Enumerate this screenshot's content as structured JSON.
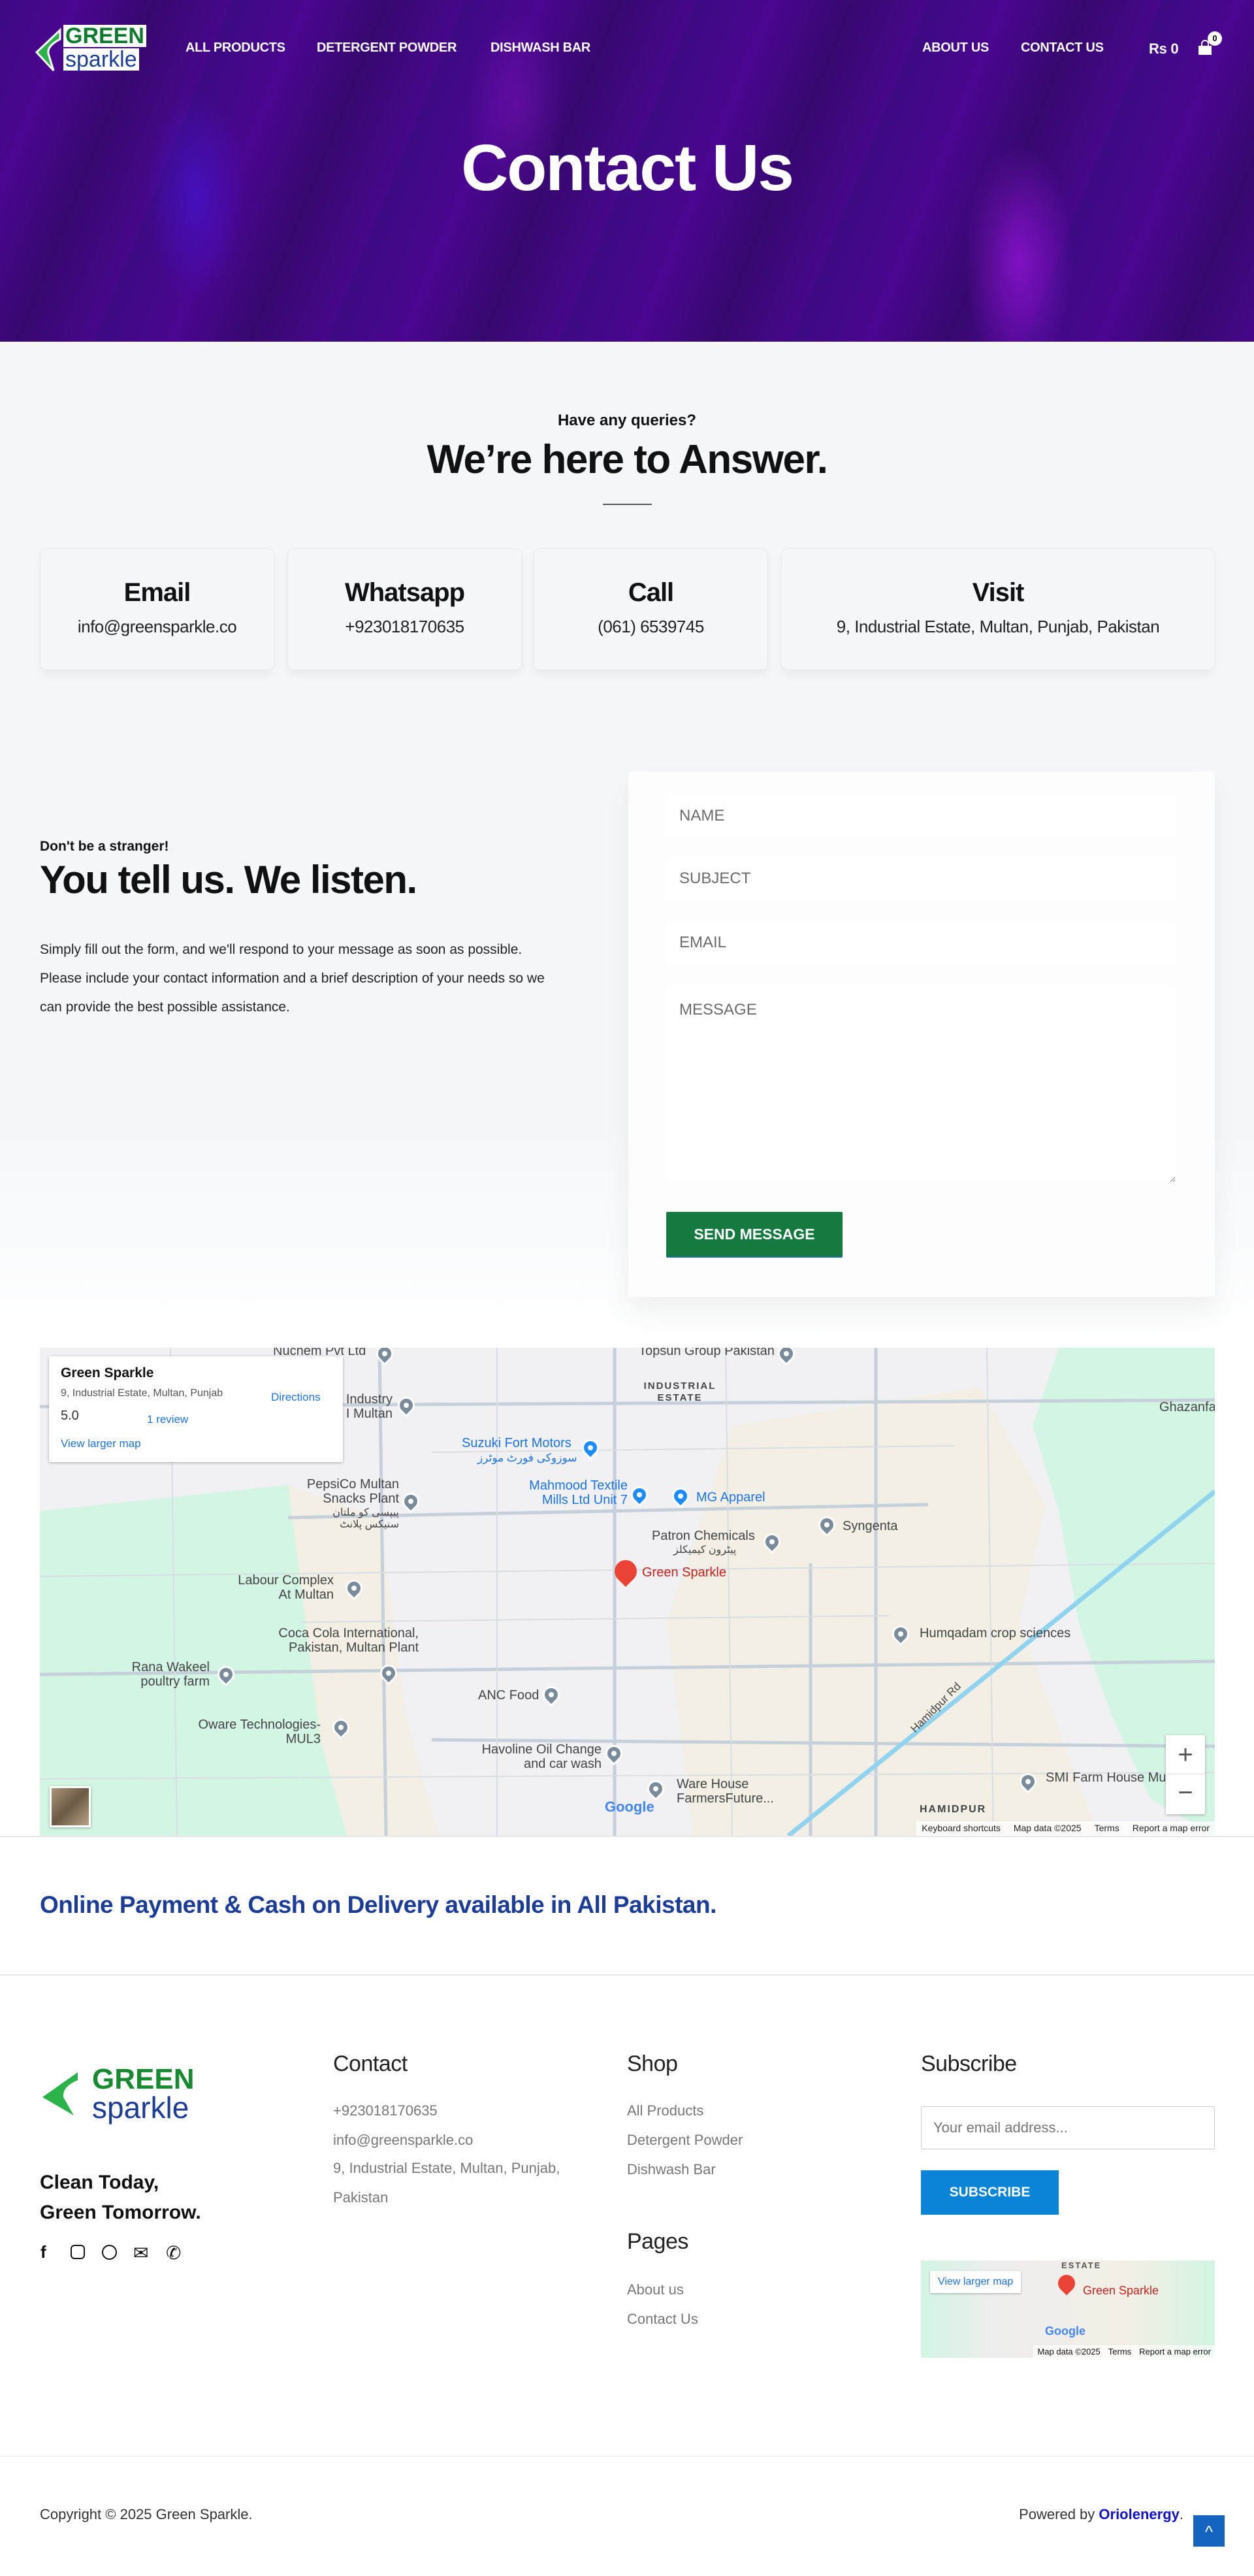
{
  "nav": {
    "logo_top": "GREEN",
    "logo_bottom": "sparkle",
    "left": [
      "ALL PRODUCTS",
      "DETERGENT POWDER",
      "DISHWASH BAR"
    ],
    "right": [
      "ABOUT US",
      "CONTACT US"
    ],
    "cart_total": "Rs 0",
    "cart_count": "0"
  },
  "hero": {
    "title": "Contact Us"
  },
  "intro": {
    "kicker": "Have any queries?",
    "heading": "We’re here to Answer."
  },
  "cards": [
    {
      "title": "Email",
      "value": "info@greensparkle.co"
    },
    {
      "title": "Whatsapp",
      "value": "+923018170635"
    },
    {
      "title": "Call",
      "value": "(061) 6539745"
    },
    {
      "title": "Visit",
      "value": "9, Industrial Estate, Multan, Punjab, Pakistan"
    }
  ],
  "contact": {
    "kicker": "Don't be a stranger!",
    "heading": "You tell us. We listen.",
    "body": "Simply fill out the form, and we'll respond to your message as soon as possible. Please include your contact information and a brief description of your needs so we can provide the best possible assistance."
  },
  "form": {
    "name_placeholder": "NAME",
    "subject_placeholder": "SUBJECT",
    "email_placeholder": "EMAIL",
    "message_placeholder": "MESSAGE",
    "submit": "SEND MESSAGE",
    "accent": "#147a40"
  },
  "map": {
    "place": "Green Sparkle",
    "address": "9, Industrial Estate, Multan, Punjab",
    "rating": "5.0",
    "reviews": "1 review",
    "directions": "Directions",
    "larger": "View larger map",
    "labels": [
      "Nuchem Pvt Ltd",
      "Topsun Group Pakistan",
      "INDUSTRIAL ESTATE",
      "Industry I Multan",
      "Suzuki Fort Motors",
      "سوزوکی فورٹ موٹرز",
      "Mahmood Textile Mills Ltd Unit 7",
      "MG Apparel",
      "PepsiCo Multan Snacks Plant",
      "پیپسی کو ملتان سنیکس پلانٹ",
      "Syngenta",
      "Patron Chemicals",
      "پیٹرون کیمیکلز",
      "Green Sparkle",
      "Ghazanfa",
      "Labour Complex At Multan",
      "Humqadam crop sciences",
      "Coca Cola International, Pakistan, Multan Plant",
      "Rana Wakeel poultry farm",
      "ANC Food",
      "Oware Technologies- MUL3",
      "Havoline Oil Change and car wash",
      "Hamidpur Rd",
      "Ware House FarmersFuture...",
      "SMI Farm House Mu",
      "HAMIDPUR"
    ],
    "footer": {
      "google": "Google",
      "shortcuts": "Keyboard shortcuts",
      "data": "Map data ©2025",
      "terms": "Terms",
      "report": "Report a map error"
    },
    "zoom_in": "+",
    "zoom_out": "−"
  },
  "banner": "Online Payment & Cash on Delivery available in All Pakistan.",
  "footer": {
    "tagline1": "Clean Today,",
    "tagline2": "Green Tomorrow.",
    "contact": {
      "title": "Contact",
      "phone": "+923018170635",
      "email": "info@greensparkle.co",
      "address": "9, Industrial Estate, Multan, Punjab, Pakistan"
    },
    "shop": {
      "title": "Shop",
      "items": [
        "All Products",
        "Detergent Powder",
        "Dishwash Bar"
      ]
    },
    "pages": {
      "title": "Pages",
      "items": [
        "About us",
        "Contact Us"
      ]
    },
    "subscribe": {
      "title": "Subscribe",
      "placeholder": "Your email address...",
      "button": "SUBSCRIBE",
      "accent": "#0a84d6"
    },
    "mini_map": {
      "larger": "View larger map",
      "place": "Green Sparkle",
      "google": "Google",
      "data": "Map data ©2025",
      "terms": "Terms",
      "report": "Report a map error",
      "estate": "ESTATE"
    },
    "copyright": "Copyright © 2025 Green Sparkle.",
    "powered_prefix": "Powered by ",
    "powered_link": "Oriolenergy",
    "powered_suffix": "."
  },
  "icons": [
    "facebook-icon",
    "instagram-icon",
    "whatsapp-icon",
    "mail-icon",
    "phone-icon",
    "cart-icon",
    "scroll-top-icon"
  ]
}
